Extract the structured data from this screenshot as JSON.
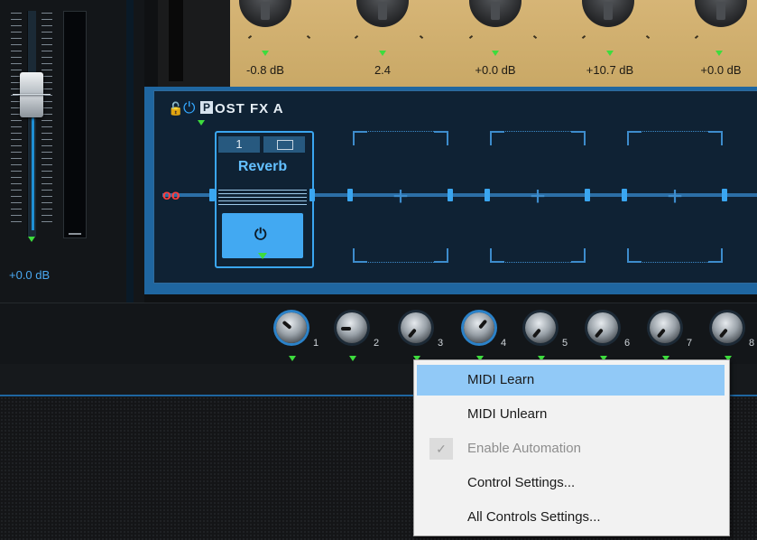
{
  "mixer": {
    "fader_value": "+0.0 dB"
  },
  "amp": {
    "values": [
      "-0.8 dB",
      "2.4",
      "+0.0 dB",
      "+10.7 dB",
      "+0.0 dB"
    ]
  },
  "fx": {
    "title_initial": "P",
    "title_rest": "OST FX A",
    "slot1": {
      "number": "1",
      "name": "Reverb"
    },
    "empty_slot_symbol": "+"
  },
  "macro_knobs": [
    "1",
    "2",
    "3",
    "4",
    "5",
    "6",
    "7",
    "8"
  ],
  "context_menu": {
    "items": [
      {
        "label": "MIDI Learn",
        "state": "highlighted"
      },
      {
        "label": "MIDI Unlearn",
        "state": "enabled"
      },
      {
        "label": "Enable Automation",
        "state": "disabled",
        "checked": true
      },
      {
        "label": "Control Settings...",
        "state": "enabled"
      },
      {
        "label": "All Controls Settings...",
        "state": "enabled"
      }
    ]
  },
  "colors": {
    "accent": "#3aa6f0",
    "indicator": "#3ddc3d",
    "menu_highlight": "#91c9f7"
  }
}
